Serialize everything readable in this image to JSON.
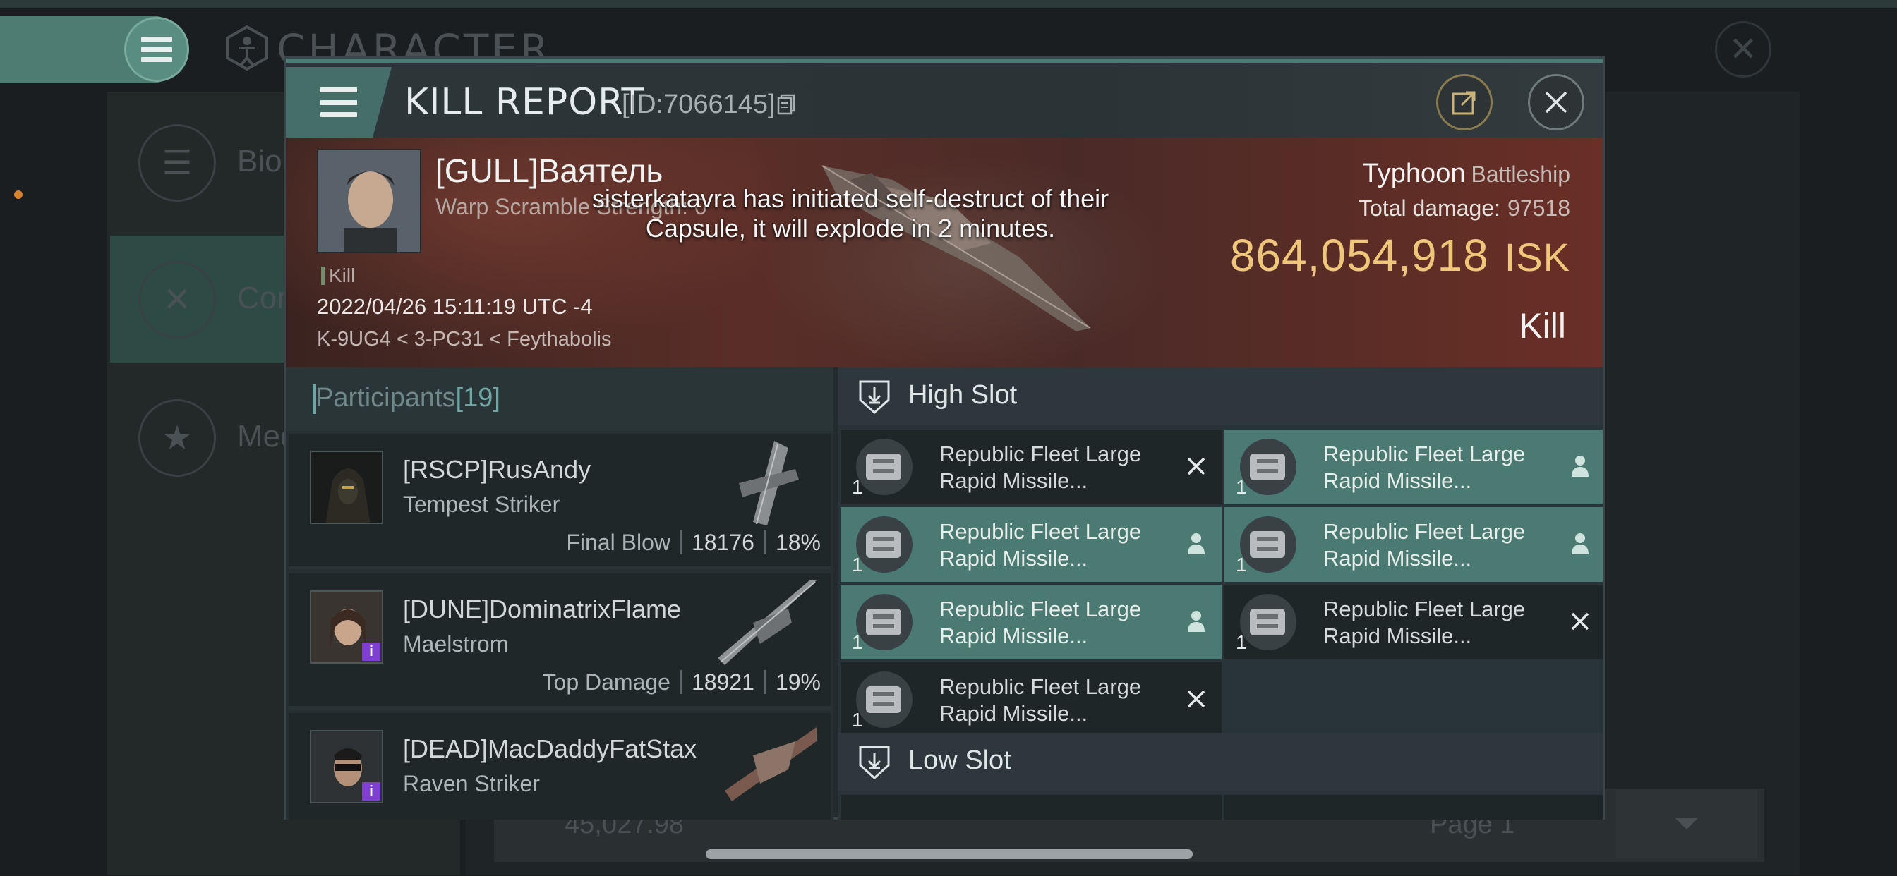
{
  "background": {
    "screen_title": "CHARACTER",
    "side_items": [
      {
        "label": "Bio"
      },
      {
        "label": "Com"
      },
      {
        "label": "Med"
      }
    ],
    "isk_balance": "45,027.98",
    "page_label": "Page 1"
  },
  "modal": {
    "title": "KILL REPORT",
    "id_text": "[ID:7066145]"
  },
  "victim": {
    "name": "[GULL]Ваятель",
    "subtitle": "Warp Scramble Strength: 0",
    "kill_tag": "Kill",
    "datetime": "2022/04/26 15:11:19 UTC -4",
    "location": "K-9UG4 < 3-PC31 < Feythabolis",
    "ship": "Typhoon",
    "ship_class": "Battleship",
    "damage_label": "Total damage:",
    "damage_value": "97518",
    "isk_value": "864,054,918",
    "isk_unit": "ISK",
    "result": "Kill"
  },
  "notification": "sisterkatavra has initiated self-destruct of their Capsule, it will explode in 2 minutes.",
  "participants": {
    "label": "Participants",
    "count": "[19]",
    "rows": [
      {
        "name": "[RSCP]RusAndy",
        "ship": "Tempest Striker",
        "stat_label": "Final Blow",
        "damage": "18176",
        "percent": "18%"
      },
      {
        "name": "[DUNE]DominatrixFlame",
        "ship": "Maelstrom",
        "stat_label": "Top Damage",
        "damage": "18921",
        "percent": "19%"
      },
      {
        "name": "[DEAD]MacDaddyFatStax",
        "ship": "Raven Striker",
        "stat_label": "",
        "damage": "",
        "percent": ""
      }
    ]
  },
  "slots": {
    "high_label": "High Slot",
    "low_label": "Low Slot",
    "high_modules": [
      {
        "name": "Republic Fleet Large Rapid Missile...",
        "qty": "1",
        "status": "destroyed"
      },
      {
        "name": "Republic Fleet Large Rapid Missile...",
        "qty": "1",
        "status": "dropped"
      },
      {
        "name": "Republic Fleet Large Rapid Missile...",
        "qty": "1",
        "status": "dropped"
      },
      {
        "name": "Republic Fleet Large Rapid Missile...",
        "qty": "1",
        "status": "dropped"
      },
      {
        "name": "Republic Fleet Large Rapid Missile...",
        "qty": "1",
        "status": "dropped"
      },
      {
        "name": "Republic Fleet Large Rapid Missile...",
        "qty": "1",
        "status": "destroyed"
      },
      {
        "name": "Republic Fleet Large Rapid Missile...",
        "qty": "1",
        "status": "destroyed"
      }
    ]
  },
  "colors": {
    "accent": "#4a7a71",
    "isk_gold": "#f0c77a",
    "banner": "#5a2e28"
  }
}
